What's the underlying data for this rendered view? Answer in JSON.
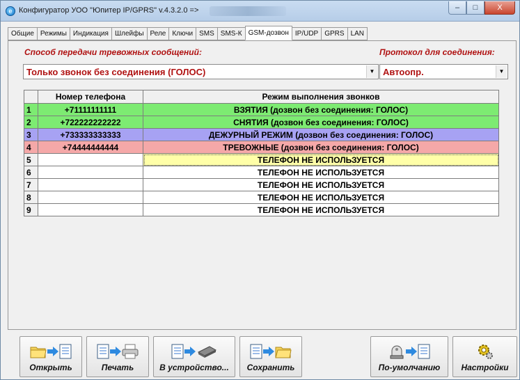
{
  "window": {
    "title": "Конфигуратор УОО \"Юпитер IP/GPRS\" v.4.3.2.0  =>",
    "minimize": "–",
    "maximize": "□",
    "close": "X"
  },
  "tabs": [
    {
      "label": "Общие"
    },
    {
      "label": "Режимы"
    },
    {
      "label": "Индикация"
    },
    {
      "label": "Шлейфы"
    },
    {
      "label": "Реле"
    },
    {
      "label": "Ключи"
    },
    {
      "label": "SMS"
    },
    {
      "label": "SMS-К"
    },
    {
      "label": "GSM-дозвон",
      "active": true
    },
    {
      "label": "IP/UDP"
    },
    {
      "label": "GPRS"
    },
    {
      "label": "LAN"
    }
  ],
  "transfer": {
    "label": "Способ передачи тревожных сообщений:",
    "value": "Только звонок без соединения (ГОЛОС)"
  },
  "protocol": {
    "label": "Протокол для соединения:",
    "value": "Автоопр."
  },
  "grid": {
    "headers": [
      "",
      "Номер телефона",
      "Режим выполнения звонков"
    ],
    "rows": [
      {
        "n": "1",
        "phone": "+71111111111",
        "mode": "ВЗЯТИЯ (дозвон без соединения: ГОЛОС)",
        "color": "green"
      },
      {
        "n": "2",
        "phone": "+722222222222",
        "mode": "СНЯТИЯ (дозвон без соединения: ГОЛОС)",
        "color": "green"
      },
      {
        "n": "3",
        "phone": "+733333333333",
        "mode": "ДЕЖУРНЫЙ РЕЖИМ (дозвон без соединения: ГОЛОС)",
        "color": "blue"
      },
      {
        "n": "4",
        "phone": "+74444444444",
        "mode": "ТРЕВОЖНЫЕ (дозвон без соединения: ГОЛОС)",
        "color": "red"
      },
      {
        "n": "5",
        "phone": "",
        "mode": "ТЕЛЕФОН НЕ ИСПОЛЬЗУЕТСЯ",
        "color": "empty",
        "selected": true
      },
      {
        "n": "6",
        "phone": "",
        "mode": "ТЕЛЕФОН НЕ ИСПОЛЬЗУЕТСЯ",
        "color": "empty"
      },
      {
        "n": "7",
        "phone": "",
        "mode": "ТЕЛЕФОН НЕ ИСПОЛЬЗУЕТСЯ",
        "color": "empty"
      },
      {
        "n": "8",
        "phone": "",
        "mode": "ТЕЛЕФОН НЕ ИСПОЛЬЗУЕТСЯ",
        "color": "empty"
      },
      {
        "n": "9",
        "phone": "",
        "mode": "ТЕЛЕФОН НЕ ИСПОЛЬЗУЕТСЯ",
        "color": "empty"
      }
    ]
  },
  "buttons": {
    "open": "Открыть",
    "print": "Печать",
    "to_device": "В устройство...",
    "save": "Сохранить",
    "defaults": "По-умолчанию",
    "settings": "Настройки"
  },
  "colors": {
    "accent_red": "#b01212",
    "row_green": "#7deb72",
    "row_blue": "#a7a2f3",
    "row_red": "#f5a8a8",
    "row_selected": "#ffffa8"
  }
}
